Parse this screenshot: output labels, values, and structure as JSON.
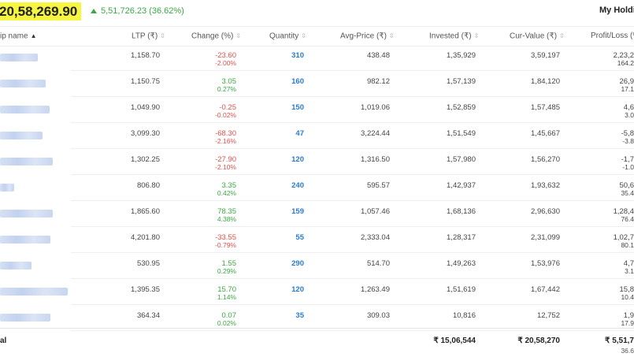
{
  "summary": {
    "total_value": "20,58,269.90",
    "day_gain": "5,51,726.23 (36.62%)",
    "holdings_title": "My Holdin"
  },
  "colors": {
    "positive": "#3aa845",
    "negative": "#df514c",
    "quantity": "#2a7bd0",
    "highlight": "#f5f542"
  },
  "table": {
    "headers": {
      "name": "ip name",
      "ltp": "LTP (₹)",
      "change": "Change (%)",
      "quantity": "Quantity",
      "avg_price": "Avg-Price (₹)",
      "invested": "Invested (₹)",
      "cur_value": "Cur-Value (₹)",
      "pl": "Profit/Loss (%"
    },
    "rows": [
      {
        "ltp": "1,158.70",
        "change": "-23.60",
        "change_pct": "-2.00%",
        "quantity": "310",
        "avg_price": "438.48",
        "invested": "1,35,929",
        "cur_value": "3,59,197",
        "pl": "2,23,2",
        "pl_pct": "164.2",
        "trend": "neg"
      },
      {
        "ltp": "1,150.75",
        "change": "3.05",
        "change_pct": "0.27%",
        "quantity": "160",
        "avg_price": "982.12",
        "invested": "1,57,139",
        "cur_value": "1,84,120",
        "pl": "26,9",
        "pl_pct": "17.1",
        "trend": "pos"
      },
      {
        "ltp": "1,049.90",
        "change": "-0.25",
        "change_pct": "-0.02%",
        "quantity": "150",
        "avg_price": "1,019.06",
        "invested": "1,52,859",
        "cur_value": "1,57,485",
        "pl": "4,6",
        "pl_pct": "3.0",
        "trend": "neg"
      },
      {
        "ltp": "3,099.30",
        "change": "-68.30",
        "change_pct": "-2.16%",
        "quantity": "47",
        "avg_price": "3,224.44",
        "invested": "1,51,549",
        "cur_value": "1,45,667",
        "pl": "-5,8",
        "pl_pct": "-3.8",
        "trend": "neg"
      },
      {
        "ltp": "1,302.25",
        "change": "-27.90",
        "change_pct": "-2.10%",
        "quantity": "120",
        "avg_price": "1,316.50",
        "invested": "1,57,980",
        "cur_value": "1,56,270",
        "pl": "-1,7",
        "pl_pct": "-1.0",
        "trend": "neg"
      },
      {
        "ltp": "806.80",
        "change": "3.35",
        "change_pct": "0.42%",
        "quantity": "240",
        "avg_price": "595.57",
        "invested": "1,42,937",
        "cur_value": "1,93,632",
        "pl": "50,6",
        "pl_pct": "35.4",
        "trend": "pos"
      },
      {
        "ltp": "1,865.60",
        "change": "78.35",
        "change_pct": "4.38%",
        "quantity": "159",
        "avg_price": "1,057.46",
        "invested": "1,68,136",
        "cur_value": "2,96,630",
        "pl": "1,28,4",
        "pl_pct": "76.4",
        "trend": "pos"
      },
      {
        "ltp": "4,201.80",
        "change": "-33.55",
        "change_pct": "-0.79%",
        "quantity": "55",
        "avg_price": "2,333.04",
        "invested": "1,28,317",
        "cur_value": "2,31,099",
        "pl": "1,02,7",
        "pl_pct": "80.1",
        "trend": "neg"
      },
      {
        "ltp": "530.95",
        "change": "1.55",
        "change_pct": "0.29%",
        "quantity": "290",
        "avg_price": "514.70",
        "invested": "1,49,263",
        "cur_value": "1,53,976",
        "pl": "4,7",
        "pl_pct": "3.1",
        "trend": "pos"
      },
      {
        "ltp": "1,395.35",
        "change": "15.70",
        "change_pct": "1.14%",
        "quantity": "120",
        "avg_price": "1,263.49",
        "invested": "1,51,619",
        "cur_value": "1,67,442",
        "pl": "15,8",
        "pl_pct": "10.4",
        "trend": "pos"
      },
      {
        "ltp": "364.34",
        "change": "0.07",
        "change_pct": "0.02%",
        "quantity": "35",
        "avg_price": "309.03",
        "invested": "10,816",
        "cur_value": "12,752",
        "pl": "1,9",
        "pl_pct": "17.9",
        "trend": "pos"
      }
    ],
    "footer": {
      "label": "al",
      "invested": "₹ 15,06,544",
      "cur_value": "₹ 20,58,270",
      "pl": "₹ 5,51,7",
      "pl_pct": "36.6"
    }
  }
}
